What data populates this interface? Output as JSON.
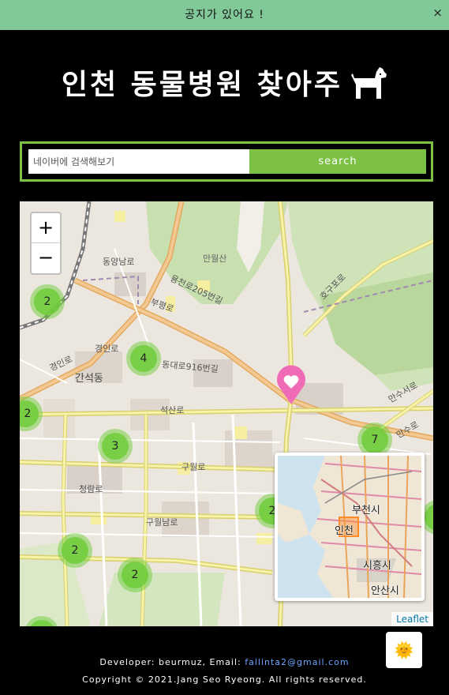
{
  "notice": {
    "text": "공지가 있어요 !",
    "close_label": "×"
  },
  "header": {
    "title": "인천 동물병원 찾아주",
    "logo_icon": "dog-icon"
  },
  "search": {
    "placeholder": "네이버에 검색해보기",
    "button_label": "search",
    "accent": "#7cc144"
  },
  "map": {
    "zoom_in_label": "+",
    "zoom_out_label": "−",
    "attribution": "Leaflet",
    "marker_icon": "heart-pin-icon",
    "marker_color": "#f06bb5",
    "clusters": [
      {
        "count": "2"
      },
      {
        "count": "4"
      },
      {
        "count": "2"
      },
      {
        "count": "3"
      },
      {
        "count": "7"
      },
      {
        "count": "2"
      },
      {
        "count": "2"
      },
      {
        "count": "2"
      }
    ],
    "street_labels": [
      "동양남로",
      "경인로",
      "용천로205번길",
      "부평로",
      "경인로",
      "동대로916번길",
      "간석동",
      "석산로",
      "구월로",
      "구월남로",
      "청람로",
      "만월산",
      "만수서로",
      "만수로",
      "호구포로"
    ],
    "minimap": {
      "labels": [
        "부천시",
        "인천",
        "시흥시",
        "안산시"
      ]
    }
  },
  "theme_toggle": {
    "icon": "sun-icon",
    "glyph": "🌞"
  },
  "footer": {
    "developer_prefix": "Developer: beurmuz, Email: ",
    "email": "fallinta2@gmail.com",
    "copyright": "Copyright © 2021.Jang Seo Ryeong. All rights reserved."
  }
}
